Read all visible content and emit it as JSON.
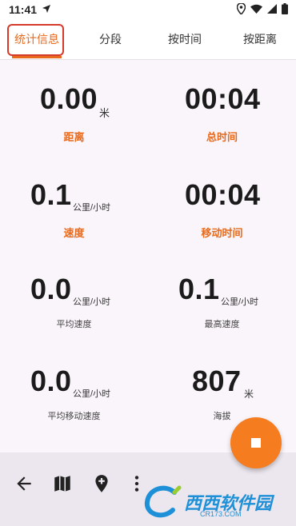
{
  "status_bar": {
    "time": "11:41"
  },
  "tabs": [
    {
      "label": "统计信息"
    },
    {
      "label": "分段"
    },
    {
      "label": "按时间"
    },
    {
      "label": "按距离"
    }
  ],
  "stats": {
    "distance": {
      "value": "0.00",
      "unit": "米",
      "label": "距离"
    },
    "total_time": {
      "value": "00:04",
      "label": "总时间"
    },
    "speed": {
      "value": "0.1",
      "unit": "公里/小时",
      "label": "速度"
    },
    "moving_time": {
      "value": "00:04",
      "label": "移动时间"
    },
    "avg_speed": {
      "value": "0.0",
      "unit": "公里/小时",
      "label": "平均速度"
    },
    "max_speed": {
      "value": "0.1",
      "unit": "公里/小时",
      "label": "最高速度"
    },
    "avg_moving_speed": {
      "value": "0.0",
      "unit": "公里/小时",
      "label": "平均移动速度"
    },
    "elevation": {
      "value": "807",
      "unit": "米",
      "label": "海拔"
    }
  },
  "bottom_bar": {
    "icons": [
      "back-arrow-icon",
      "map-icon",
      "add-marker-icon",
      "more-vert-icon"
    ]
  },
  "fab": {
    "icon": "stop-icon"
  },
  "watermark": {
    "brand": "西西软件园",
    "url": "CR173.COM"
  },
  "colors": {
    "accent": "#E86A1C",
    "fab": "#F57C1F",
    "highlight_border": "#D63A2A",
    "background": "#FAF5FA",
    "bottom_bar": "#ECE6EE"
  }
}
